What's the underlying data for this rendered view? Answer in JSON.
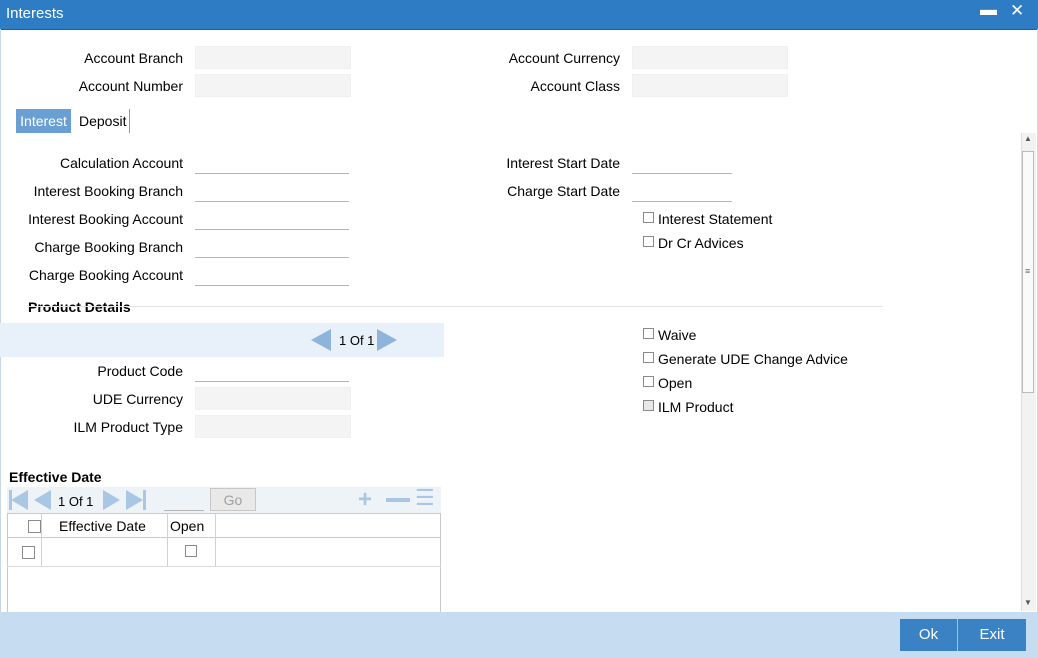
{
  "window": {
    "title": "Interests"
  },
  "header": {
    "account_branch_label": "Account Branch",
    "account_number_label": "Account Number",
    "account_currency_label": "Account Currency",
    "account_class_label": "Account Class"
  },
  "tabs": [
    {
      "label": "Interest",
      "active": true
    },
    {
      "label": "Deposit",
      "active": false
    }
  ],
  "interest": {
    "calculation_account_label": "Calculation Account",
    "interest_booking_branch_label": "Interest Booking Branch",
    "interest_booking_account_label": "Interest Booking Account",
    "charge_booking_branch_label": "Charge Booking Branch",
    "charge_booking_account_label": "Charge Booking Account",
    "interest_start_date_label": "Interest Start Date",
    "charge_start_date_label": "Charge Start Date",
    "interest_statement_label": "Interest Statement",
    "dr_cr_advices_label": "Dr Cr Advices"
  },
  "product_details": {
    "section_title": "Product Details",
    "pager_text": "1 Of 1",
    "product_code_label": "Product Code",
    "ude_currency_label": "UDE Currency",
    "ilm_product_type_label": "ILM Product Type",
    "waive_label": "Waive",
    "generate_ude_label": "Generate UDE Change Advice",
    "open_label": "Open",
    "ilm_product_label": "ILM Product"
  },
  "effective_date": {
    "section_title": "Effective Date",
    "pager_text": "1 Of 1",
    "go_label": "Go",
    "columns": [
      "Effective Date",
      "Open"
    ]
  },
  "footer": {
    "ok_label": "Ok",
    "exit_label": "Exit"
  }
}
